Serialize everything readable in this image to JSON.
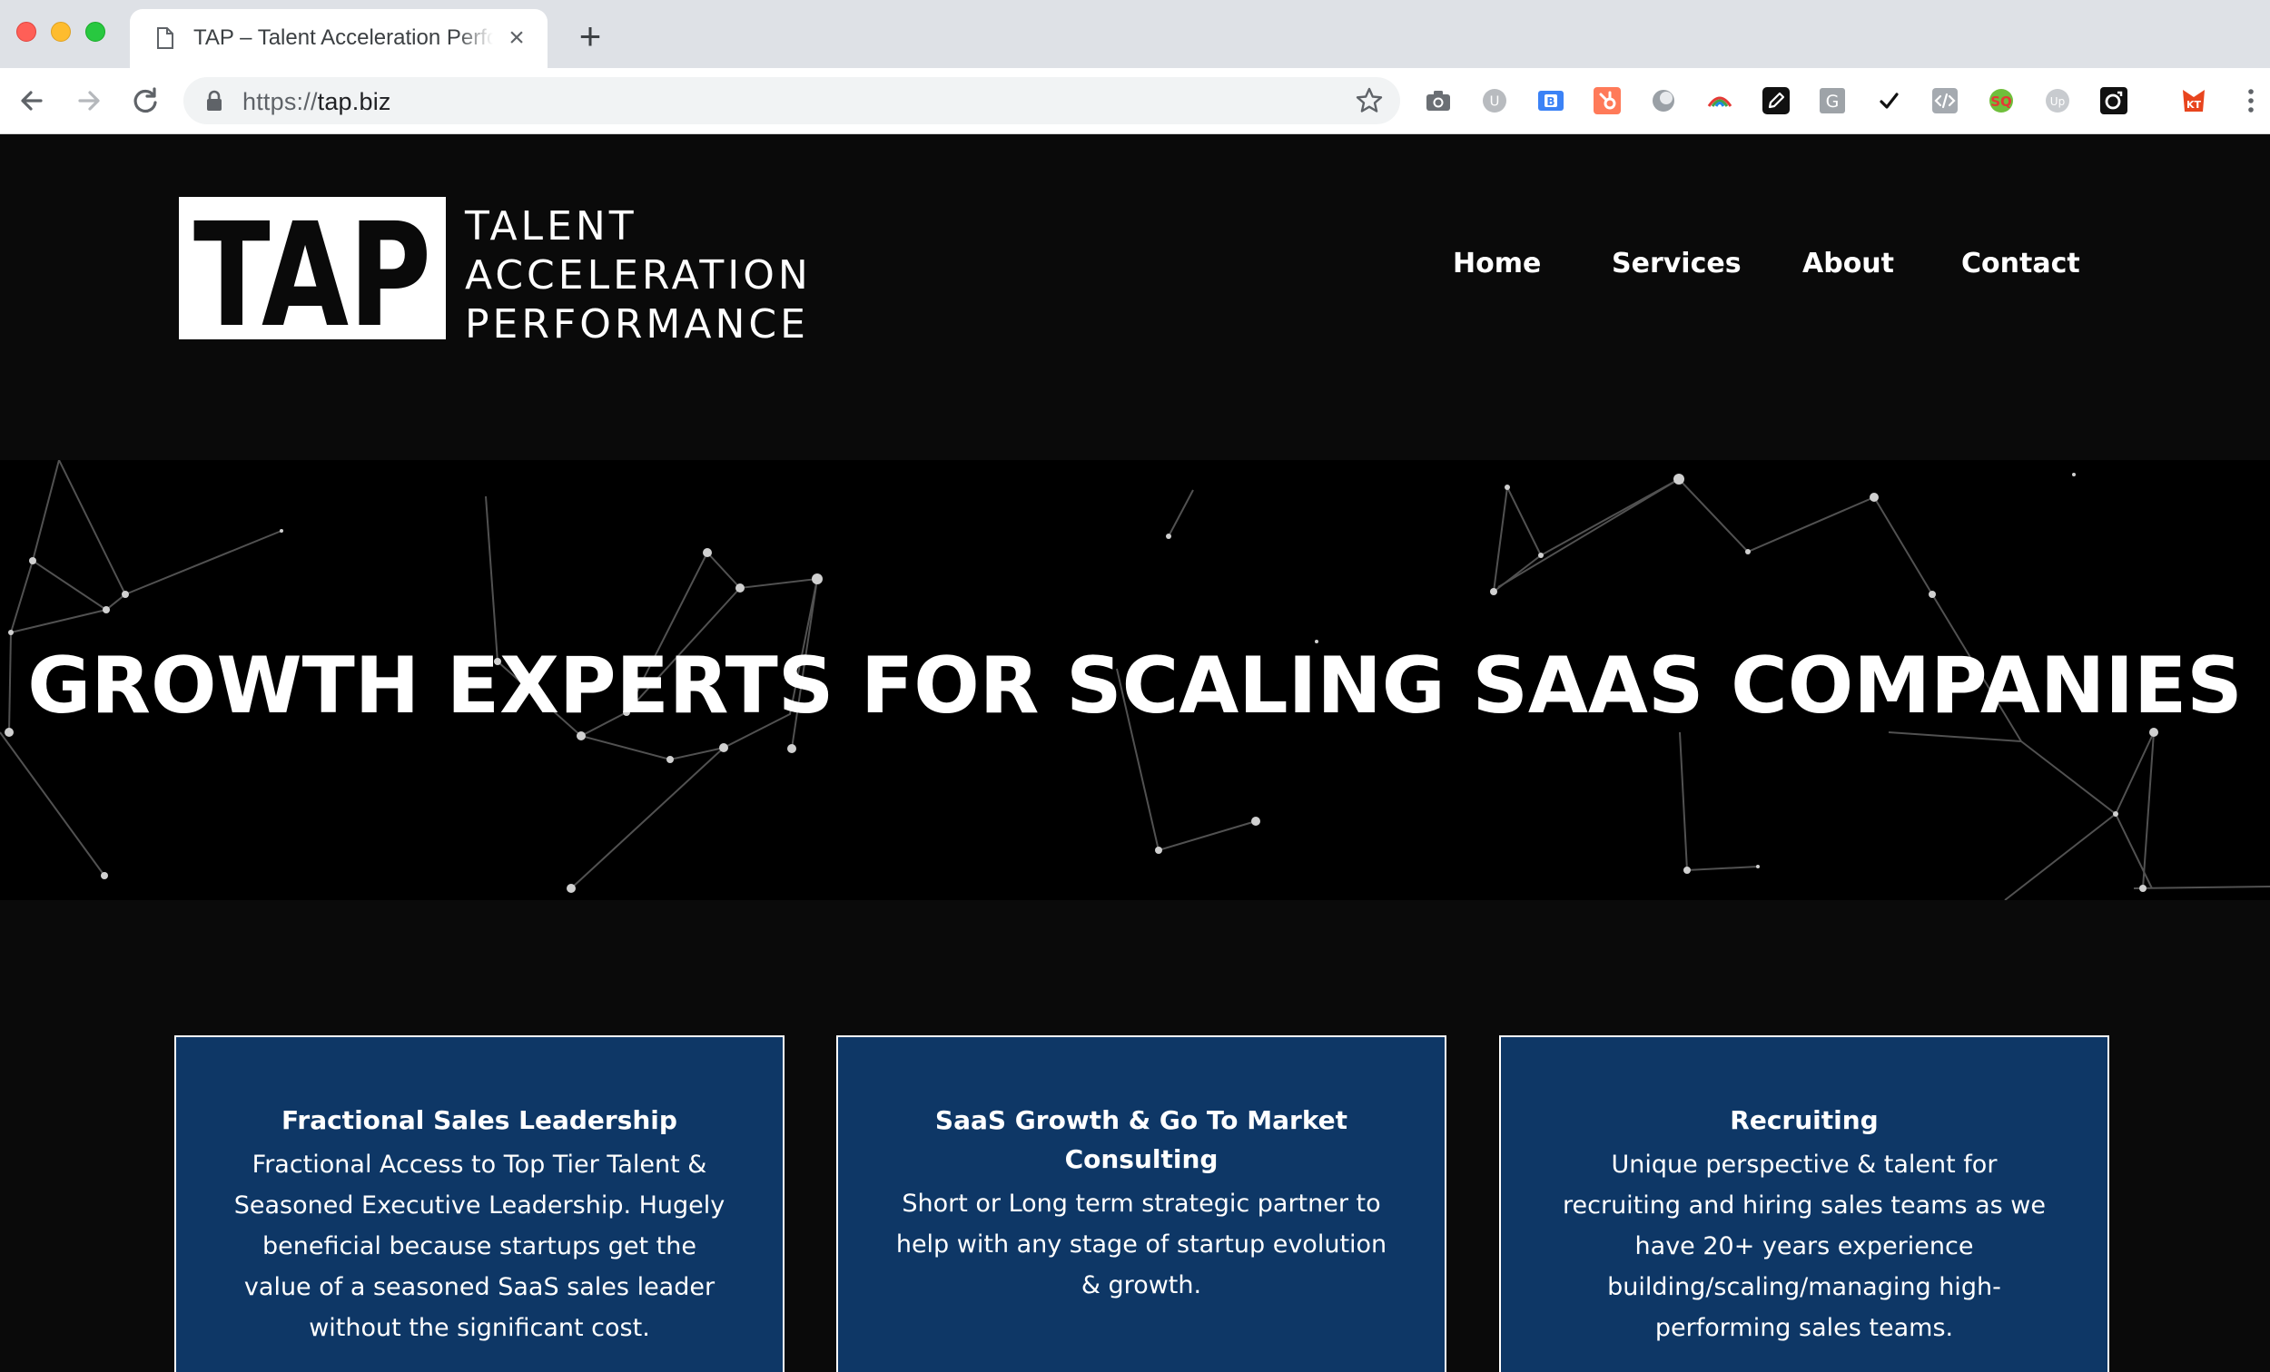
{
  "browser": {
    "tab_title": "TAP – Talent Acceleration Performance",
    "new_tab_label": "+",
    "close_label": "×",
    "url_scheme": "https://",
    "url_host": "tap.biz",
    "extensions": [
      "camera-extension-icon",
      "timer-extension-icon",
      "bitly-extension-icon",
      "hubspot-extension-icon",
      "circle-extension-icon",
      "rainbow-extension-icon",
      "pen-extension-icon",
      "grammar-extension-icon",
      "check-extension-icon",
      "code-extension-icon",
      "seoquake-extension-icon",
      "upwork-extension-icon",
      "tracking-extension-icon",
      "kt-extension-icon"
    ]
  },
  "site": {
    "logo": {
      "mark": "TAP",
      "words": [
        "TALENT",
        "ACCELERATION",
        "PERFORMANCE"
      ]
    },
    "nav": [
      {
        "label": "Home"
      },
      {
        "label": "Services"
      },
      {
        "label": "About"
      },
      {
        "label": "Contact"
      }
    ]
  },
  "hero": {
    "title": "GROWTH EXPERTS FOR SCALING SAAS COMPANIES"
  },
  "services": [
    {
      "title": "Fractional Sales Leadership",
      "body": "Fractional Access to Top Tier Talent & Seasoned Executive Leadership. Hugely beneficial because startups get the value of a seasoned SaaS sales leader without the significant cost."
    },
    {
      "title": "SaaS Growth & Go To Market Consulting",
      "body": "Short or Long term strategic partner to help with any stage of startup evolution & growth."
    },
    {
      "title": "Recruiting",
      "body": "Unique perspective & talent for recruiting and hiring sales teams as we have 20+ years experience building/scaling/managing high-performing sales teams."
    }
  ],
  "colors": {
    "page_bg": "#0a0a0a",
    "hero_bg": "#000000",
    "card_bg": "#0e3766",
    "text": "#ffffff"
  }
}
